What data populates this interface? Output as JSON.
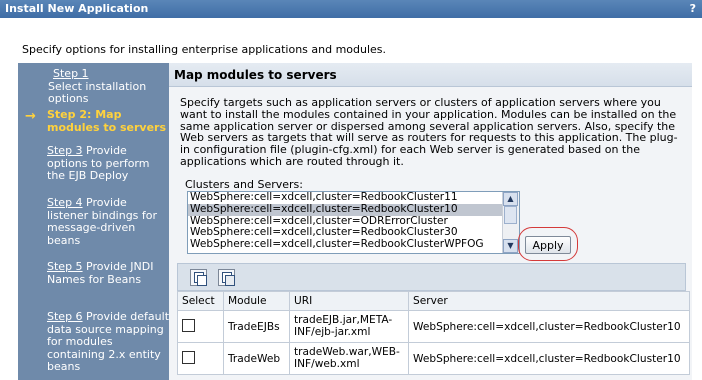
{
  "window": {
    "title": "Install New Application",
    "help_label": "?"
  },
  "description": "Specify options for installing enterprise applications and modules.",
  "steps": [
    {
      "link": "Step 1",
      "text": "Select installation options"
    },
    {
      "link": "Step 2: Map modules to servers",
      "text": ""
    },
    {
      "link": "Step 3",
      "text": "Provide options to perform the EJB Deploy"
    },
    {
      "link": "Step 4",
      "text": "Provide listener bindings for message-driven beans"
    },
    {
      "link": "Step 5",
      "text": "Provide JNDI Names for Beans"
    },
    {
      "link": "Step 6",
      "text": "Provide default data source mapping for modules containing 2.x entity beans"
    }
  ],
  "current_step_arrow": "→",
  "panel": {
    "title": "Map modules to servers",
    "description_lines": [
      "Specify targets such as application servers or clusters of application servers where you",
      "want to install the modules contained in your application. Modules can be installed on the",
      "same application server or dispersed among several application servers. Also, specify the",
      "Web servers as targets that will serve as routers for requests to this application. The plug-",
      "in configuration file (plugin-cfg.xml) for each Web server is generated based on the",
      "applications which are routed through it."
    ],
    "clusters_label": "Clusters and Servers:",
    "clusters": [
      "WebSphere:cell=xdcell,cluster=RedbookCluster11",
      "WebSphere:cell=xdcell,cluster=RedbookCluster10",
      "WebSphere:cell=xdcell,cluster=ODRErrorCluster",
      "WebSphere:cell=xdcell,cluster=RedbookCluster30",
      "WebSphere:cell=xdcell,cluster=RedbookClusterWPFOG"
    ],
    "selected_cluster_index": 1,
    "apply_label": "Apply",
    "highlight_color": "#d43a3a"
  },
  "table": {
    "headers": [
      "Select",
      "Module",
      "URI",
      "Server"
    ],
    "rows": [
      {
        "module": "TradeEJBs",
        "uri_line1": "tradeEJB.jar,META-",
        "uri_line2": "INF/ejb-jar.xml",
        "server": "WebSphere:cell=xdcell,cluster=RedbookCluster10"
      },
      {
        "module": "TradeWeb",
        "uri_line1": "tradeWeb.war,WEB-",
        "uri_line2": "INF/web.xml",
        "server": "WebSphere:cell=xdcell,cluster=RedbookCluster10"
      }
    ]
  },
  "icons": [
    "help-icon",
    "select-all-icon",
    "deselect-all-icon",
    "scroll-up-icon",
    "scroll-down-icon",
    "current-step-arrow-icon"
  ]
}
